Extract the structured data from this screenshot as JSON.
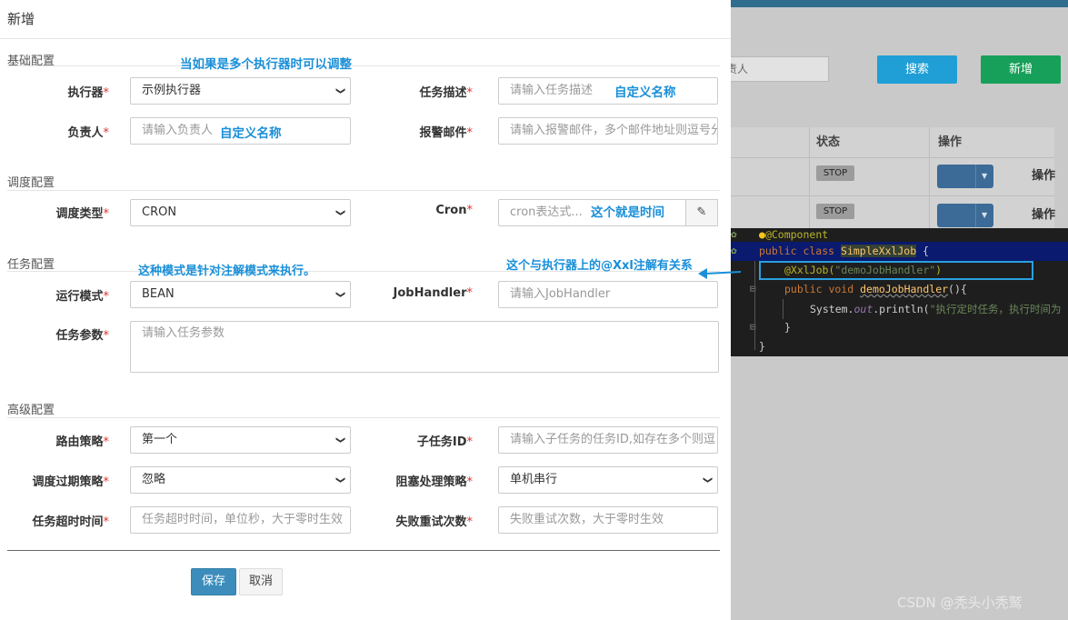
{
  "background": {
    "search_placeholder": "责人",
    "search_button": "搜索",
    "add_button": "新增",
    "table_headers": [
      "状态",
      "操作"
    ],
    "rows": [
      {
        "status": "STOP",
        "action": "操作"
      },
      {
        "status": "STOP",
        "action": "操作"
      }
    ],
    "watermark": "CSDN @秃头小秃鹫"
  },
  "code": {
    "line0": "@Component",
    "line1_kw": "public class",
    "line1_name": "SimpleXxlJob",
    "line1_end": " {",
    "line2_ann": "@XxlJob(",
    "line2_str": "\"demoJobHandler\"",
    "line2_end": ")",
    "line3_kw": "public void",
    "line3_fn": "demoJobHandler",
    "line3_end": "(){",
    "line4_a": "System.",
    "line4_out": "out",
    "line4_b": ".println(",
    "line4_str": "\"执行定时任务，执行时间为",
    "line5": "}",
    "line6": "}"
  },
  "modal": {
    "title": "新增",
    "sections": {
      "basic": "基础配置",
      "schedule": "调度配置",
      "task": "任务配置",
      "advanced": "高级配置"
    },
    "fields": {
      "executor": {
        "label": "执行器",
        "value": "示例执行器"
      },
      "job_desc": {
        "label": "任务描述",
        "placeholder": "请输入任务描述"
      },
      "author": {
        "label": "负责人",
        "placeholder": "请输入负责人"
      },
      "alarm_email": {
        "label": "报警邮件",
        "placeholder": "请输入报警邮件，多个邮件地址则逗号分"
      },
      "schedule_type": {
        "label": "调度类型",
        "value": "CRON"
      },
      "cron": {
        "label": "Cron",
        "placeholder": "cron表达式..."
      },
      "run_mode": {
        "label": "运行模式",
        "value": "BEAN"
      },
      "job_handler": {
        "label": "JobHandler",
        "placeholder": "请输入JobHandler"
      },
      "job_param": {
        "label": "任务参数",
        "placeholder": "请输入任务参数"
      },
      "route_strategy": {
        "label": "路由策略",
        "value": "第一个"
      },
      "child_job_id": {
        "label": "子任务ID",
        "placeholder": "请输入子任务的任务ID,如存在多个则逗"
      },
      "misfire_strategy": {
        "label": "调度过期策略",
        "value": "忽略"
      },
      "block_strategy": {
        "label": "阻塞处理策略",
        "value": "单机串行"
      },
      "timeout": {
        "label": "任务超时时间",
        "placeholder": "任务超时时间，单位秒，大于零时生效"
      },
      "fail_retry": {
        "label": "失败重试次数",
        "placeholder": "失败重试次数，大于零时生效"
      }
    },
    "required_mark": "*",
    "buttons": {
      "save": "保存",
      "cancel": "取消"
    }
  },
  "annotations": {
    "multi_executor": "当如果是多个执行器时可以调整",
    "custom_name_desc": "自定义名称",
    "custom_name_author": "自定义名称",
    "cron_note": "这个就是时间",
    "annotation_mode": "这种模式是针对注解模式来执行。",
    "xxl_relation": "这个与执行器上的@Xxl注解有关系"
  },
  "colors": {
    "accent": "#3c8dbc",
    "note": "#1a8fd8",
    "required": "#e03030",
    "code_bg": "#1e1e1e",
    "box": "#2aa0e0"
  }
}
